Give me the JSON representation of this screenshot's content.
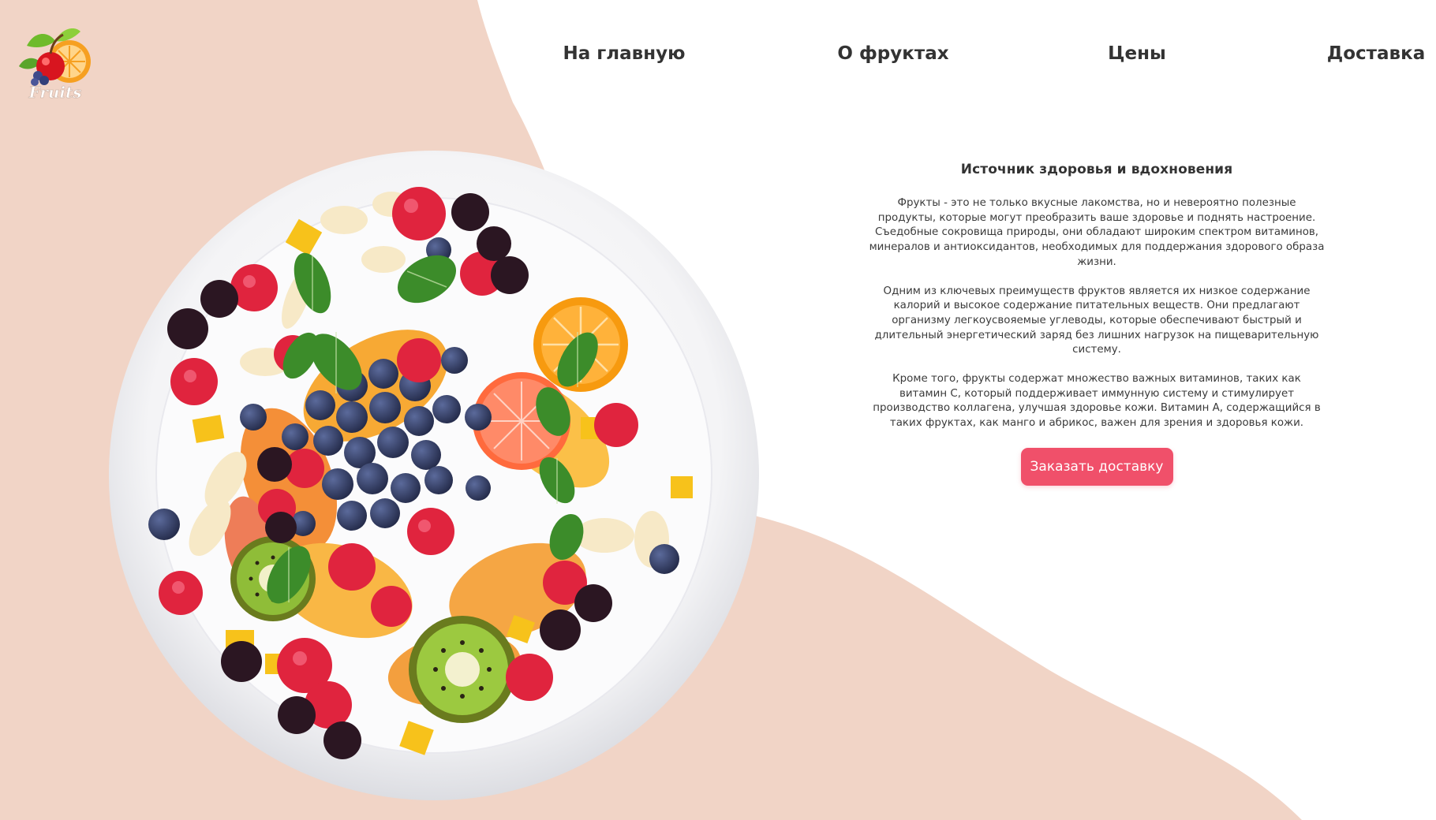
{
  "brand": {
    "logo_text": "Fruits",
    "accent": "#f0506a",
    "background": "#f1d4c6"
  },
  "nav": {
    "items": [
      {
        "label": "На главную"
      },
      {
        "label": "О фруктах"
      },
      {
        "label": "Цены"
      },
      {
        "label": "Доставка"
      }
    ]
  },
  "hero": {
    "image_icon": "fruit-plate-image",
    "title": "Источник здоровья и вдохновения",
    "paragraphs": [
      "Фрукты - это не только вкусные лакомства, но и невероятно полезные продукты, которые могут преобразить ваше здоровье и поднять настроение. Съедобные сокровища природы, они обладают широким спектром витаминов, минералов и антиоксидантов, необходимых для поддержания здорового образа жизни.",
      "Одним из ключевых преимуществ фруктов является их низкое содержание калорий и высокое содержание питательных веществ. Они предлагают организму легкоусвояемые углеводы, которые обеспечивают быстрый и длительный энергетический заряд без лишних нагрузок на пищеварительную систему.",
      "Кроме того, фрукты содержат множество важных витаминов, таких как витамин C, который поддерживает иммунную систему и стимулирует производство коллагена, улучшая здоровье кожи. Витамин A, содержащийся в таких фруктах, как манго и абрикос, важен для зрения и здоровья кожи."
    ],
    "cta_label": "Заказать доставку"
  }
}
